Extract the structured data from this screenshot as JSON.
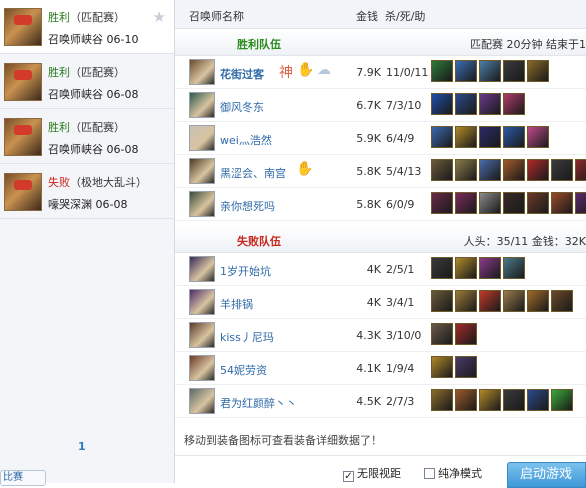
{
  "sidebar": {
    "matches": [
      {
        "result": "胜利",
        "mode": "（匹配赛）",
        "map": "召唤师峡谷",
        "date": "06-10",
        "result_type": "win",
        "selected": true
      },
      {
        "result": "胜利",
        "mode": "（匹配赛）",
        "map": "召唤师峡谷",
        "date": "06-08",
        "result_type": "win",
        "selected": false
      },
      {
        "result": "胜利",
        "mode": "（匹配赛）",
        "map": "召唤师峡谷",
        "date": "06-08",
        "result_type": "win",
        "selected": false
      },
      {
        "result": "失败",
        "mode": "（极地大乱斗）",
        "map": "嚎哭深渊",
        "date": "06-08",
        "result_type": "lose",
        "selected": false
      }
    ],
    "page": "1",
    "bottom_stub": "比赛"
  },
  "header": {
    "col_name": "召唤师名称",
    "col_gold": "金钱",
    "col_kda": "杀/死/助"
  },
  "winning_team": {
    "title": "胜利队伍",
    "info": "匹配赛  20分钟  结束于1",
    "players": [
      {
        "name": "花街过客",
        "gold": "7.9K",
        "kda": "11/0/11",
        "bold": true,
        "champ_color": "#6a4a2e",
        "items": [
          "#2e7a3a",
          "#3a6fb0",
          "#4a7ea8",
          "#3a3a3a",
          "#8a6a2a"
        ]
      },
      {
        "name": "御风冬东",
        "gold": "6.7K",
        "kda": "7/3/10",
        "bold": false,
        "champ_color": "#2c5a4a",
        "items": [
          "#1f4fa8",
          "#2a4a8a",
          "#6a3a8a",
          "#b03a6a"
        ]
      },
      {
        "name": "wei灬浩然",
        "gold": "5.9K",
        "kda": "6/4/9",
        "bold": false,
        "champ_color": "#c9c0b6",
        "items": [
          "#3a6ab0",
          "#b08a2a",
          "#2a2a6a",
          "#2a5aa8",
          "#c04a8a"
        ]
      },
      {
        "name": "黑涩会、南宫",
        "gold": "5.8K",
        "kda": "5/4/13",
        "bold": false,
        "champ_color": "#4a3a20",
        "items": [
          "#6a5a3a",
          "#8a7a4a",
          "#4a6aa8",
          "#a05a2a",
          "#b02a2a",
          "#3a3a3a",
          "#8a2a2a"
        ]
      },
      {
        "name": "亲你想死吗",
        "gold": "5.8K",
        "kda": "6/0/9",
        "bold": false,
        "champ_color": "#3a4a3a",
        "items": [
          "#6a2a4a",
          "#7a2a5a",
          "#8a8a8a",
          "#3a2a2a",
          "#6a3a2a",
          "#9a4a2a",
          "#5a2a6a"
        ]
      }
    ]
  },
  "losing_team": {
    "title": "失败队伍",
    "info": "人头：35/11  金钱：32K",
    "players": [
      {
        "name": "1岁开始坑",
        "gold": "4K",
        "kda": "2/5/1",
        "bold": false,
        "champ_color": "#3a2a5a",
        "items": [
          "#3a3a3a",
          "#b08a2a",
          "#8a3a8a",
          "#4a7a8a"
        ]
      },
      {
        "name": "羊排锅",
        "gold": "4K",
        "kda": "3/4/1",
        "bold": false,
        "champ_color": "#4a2a6a",
        "items": [
          "#6a5a3a",
          "#9a7a3a",
          "#c03a2a",
          "#9a7a4a",
          "#a06a2a",
          "#6a4a2a"
        ]
      },
      {
        "name": "kiss丿尼玛",
        "gold": "4.3K",
        "kda": "3/10/0",
        "bold": false,
        "champ_color": "#5a3a2a",
        "items": [
          "#6a5a4a",
          "#a02a2a"
        ]
      },
      {
        "name": "54妮劳资",
        "gold": "4.1K",
        "kda": "1/9/4",
        "bold": false,
        "champ_color": "#6a3a2a",
        "items": [
          "#b08a2a",
          "#4a3a6a"
        ]
      },
      {
        "name": "君为红颜醉丶丶",
        "gold": "4.5K",
        "kda": "2/7/3",
        "bold": false,
        "champ_color": "#5a6a6a",
        "items": [
          "#8a6a2a",
          "#9a5a2a",
          "#b08a2a",
          "#3a3a3a",
          "#2a4a8a",
          "#3aa83a"
        ]
      }
    ]
  },
  "tip": "移动到装备图标可查看装备详细数据了！",
  "footer": {
    "checkbox_unlimited": "无限视距",
    "checkbox_unlimited_checked": true,
    "checkbox_pure": "纯净模式",
    "checkbox_pure_checked": false,
    "start_button": "启动游戏"
  }
}
